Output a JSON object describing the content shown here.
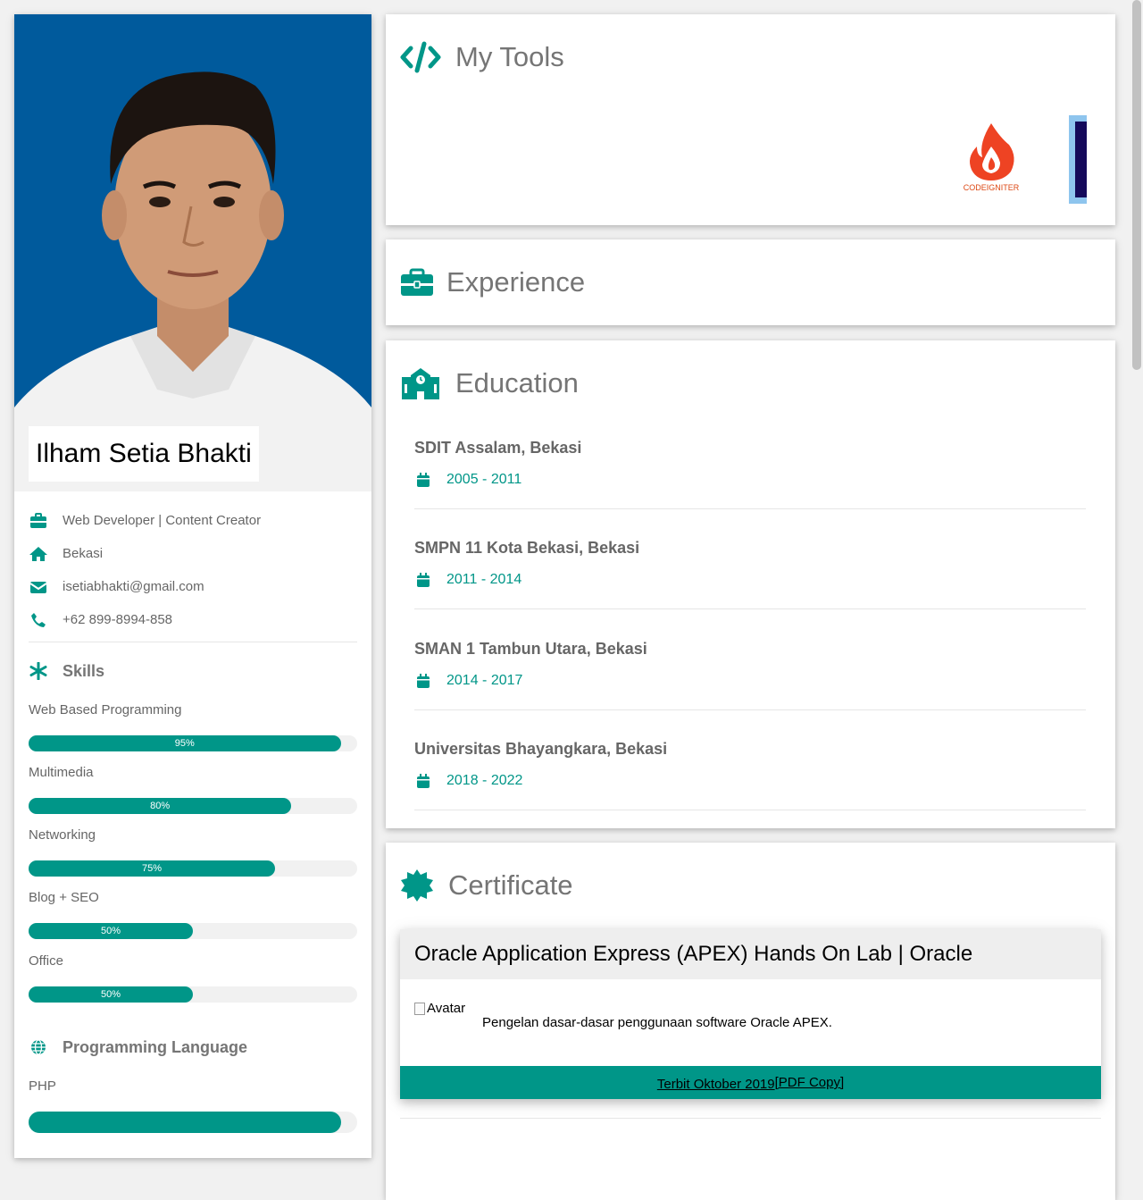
{
  "profile": {
    "name": "Ilham Setia Bhakti",
    "job": "Web Developer | Content Creator",
    "location": "Bekasi",
    "email": "isetiabhakti@gmail.com",
    "phone": "+62 899-8994-858"
  },
  "skills": {
    "title": "Skills",
    "items": [
      {
        "label": "Web Based Programming",
        "percent": 95,
        "percent_label": "95%"
      },
      {
        "label": "Multimedia",
        "percent": 80,
        "percent_label": "80%"
      },
      {
        "label": "Networking",
        "percent": 75,
        "percent_label": "75%"
      },
      {
        "label": "Blog + SEO",
        "percent": 50,
        "percent_label": "50%"
      },
      {
        "label": "Office",
        "percent": 50,
        "percent_label": "50%"
      }
    ]
  },
  "programming": {
    "title": "Programming Language",
    "items": [
      {
        "label": "PHP",
        "percent": 95
      }
    ]
  },
  "tools": {
    "title": "My Tools",
    "logo_label": "CODEIGNITER"
  },
  "experience": {
    "title": "Experience"
  },
  "education": {
    "title": "Education",
    "items": [
      {
        "school": "SDIT Assalam, Bekasi",
        "years": "2005 - 2011"
      },
      {
        "school": "SMPN 11 Kota Bekasi, Bekasi",
        "years": "2011 - 2014"
      },
      {
        "school": "SMAN 1 Tambun Utara, Bekasi",
        "years": "2014 - 2017"
      },
      {
        "school": "Universitas Bhayangkara, Bekasi",
        "years": "2018 - 2022"
      }
    ]
  },
  "certificate": {
    "title": "Certificate",
    "items": [
      {
        "name": "Oracle Application Express (APEX) Hands On Lab | Oracle",
        "avatar_alt": "Avatar",
        "description": "Pengelan dasar-dasar penggunaan software Oracle APEX.",
        "issued": "Terbit Oktober 2019",
        "pdf_label": "[PDF Copy]"
      }
    ]
  },
  "colors": {
    "accent": "#009688",
    "photo_background": "#005a9c",
    "page_background": "#f1f1f1"
  },
  "icons": {
    "job": "briefcase-icon",
    "location": "home-icon",
    "email": "envelope-icon",
    "phone": "phone-icon",
    "skills": "asterisk-icon",
    "programming": "globe-icon",
    "tools": "code-icon",
    "experience": "suitcase-icon",
    "education": "school-icon",
    "certificate": "certificate-icon",
    "year": "calendar-icon"
  }
}
